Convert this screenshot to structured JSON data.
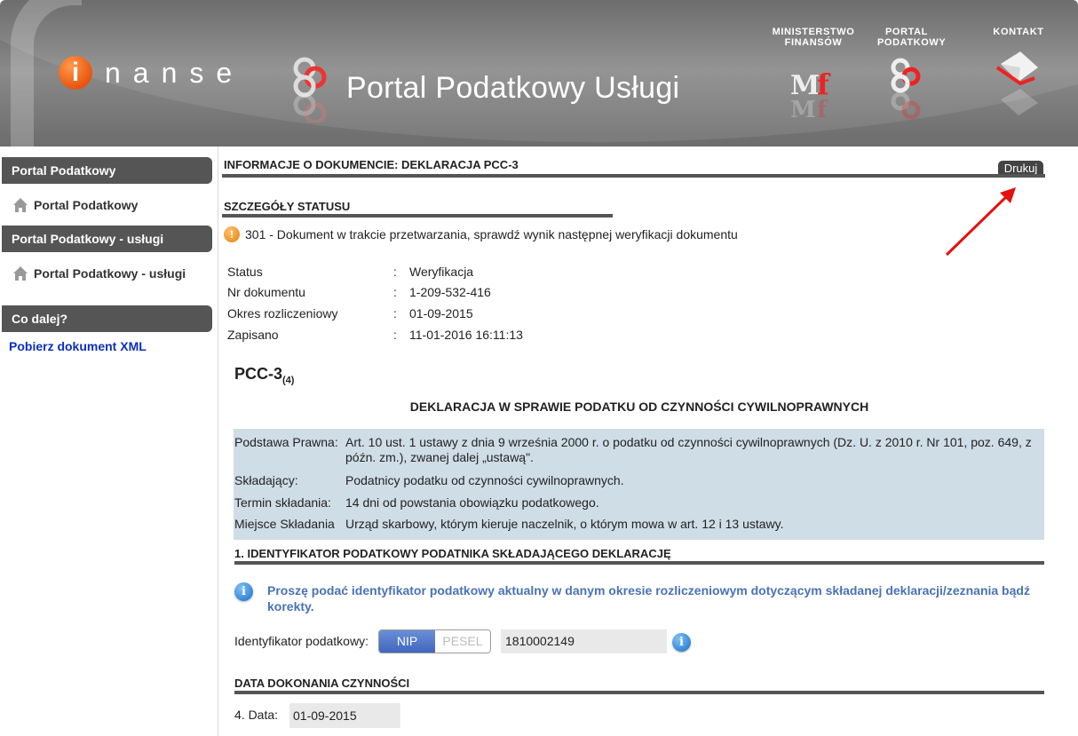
{
  "header": {
    "logo_letter": "i",
    "logo_text": "nanse",
    "portal_title": "Portal Podatkowy Usługi",
    "links": [
      {
        "line1": "MINISTERSTWO",
        "line2": "FINANSÓW"
      },
      {
        "line1": "PORTAL",
        "line2": "PODATKOWY"
      },
      {
        "line1": "KONTAKT",
        "line2": ""
      }
    ]
  },
  "sidebar": {
    "sections": [
      {
        "title": "Portal Podatkowy",
        "item": "Portal Podatkowy"
      },
      {
        "title": "Portal Podatkowy - usługi",
        "item": "Portal Podatkowy - usługi"
      },
      {
        "title": "Co dalej?",
        "item": "Pobierz dokument XML"
      }
    ]
  },
  "doc": {
    "heading": "INFORMACJE O DOKUMENCIE: DEKLARACJA PCC-3",
    "print_label": "Drukuj",
    "status_heading": "SZCZEGÓŁY STATUSU",
    "status_message": "301 - Dokument w trakcie przetwarzania, sprawdź wynik następnej weryfikacji dokumentu",
    "details": [
      {
        "key": "Status",
        "value": "Weryfikacja"
      },
      {
        "key": "Nr dokumentu",
        "value": "1-209-532-416"
      },
      {
        "key": "Okres rozliczeniowy",
        "value": "01-09-2015"
      },
      {
        "key": "Zapisano",
        "value": "11-01-2016 16:11:13"
      }
    ],
    "separator": ":"
  },
  "form": {
    "code": "PCC-3",
    "version": "(4)",
    "title": "DEKLARACJA W SPRAWIE PODATKU OD CZYNNOŚCI CYWILNOPRAWNYCH",
    "info_rows": [
      {
        "label": "Podstawa Prawna:",
        "value": "Art. 10 ust. 1 ustawy z dnia 9 września 2000 r. o podatku od czynności cywilnoprawnych (Dz. U. z 2010 r. Nr 101, poz. 649, z późn. zm.), zwanej dalej „ustawą\"."
      },
      {
        "label": "Składający:",
        "value": "Podatnicy podatku od czynności cywilnoprawnych."
      },
      {
        "label": "Termin składania:",
        "value": "14 dni od powstania obowiązku podatkowego."
      },
      {
        "label": "Miejsce Składania",
        "value": "Urząd skarbowy, którym kieruje naczelnik, o którym mowa w art. 12 i 13 ustawy."
      }
    ],
    "section1_title": "1. IDENTYFIKATOR PODATKOWY PODATNIKA SKŁADAJĄCEGO DEKLARACJĘ",
    "hint": "Proszę podać identyfikator podatkowy aktualny w danym okresie rozliczeniowym dotyczącym składanej deklaracji/zeznania bądź korekty.",
    "id_label": "Identyfikator podatkowy:",
    "id_option_nip": "NIP",
    "id_option_pesel": "PESEL",
    "id_value": "1810002149",
    "section_date_title": "DATA DOKONANIA CZYNNOŚCI",
    "date_label": "4. Data:",
    "date_value": "01-09-2015"
  },
  "colors": {
    "accent_orange": "#e8550f",
    "nav_dark": "#555555",
    "hint_blue": "#4a72b5",
    "link_blue": "#0a2fbf",
    "info_box": "#cfdde7"
  }
}
